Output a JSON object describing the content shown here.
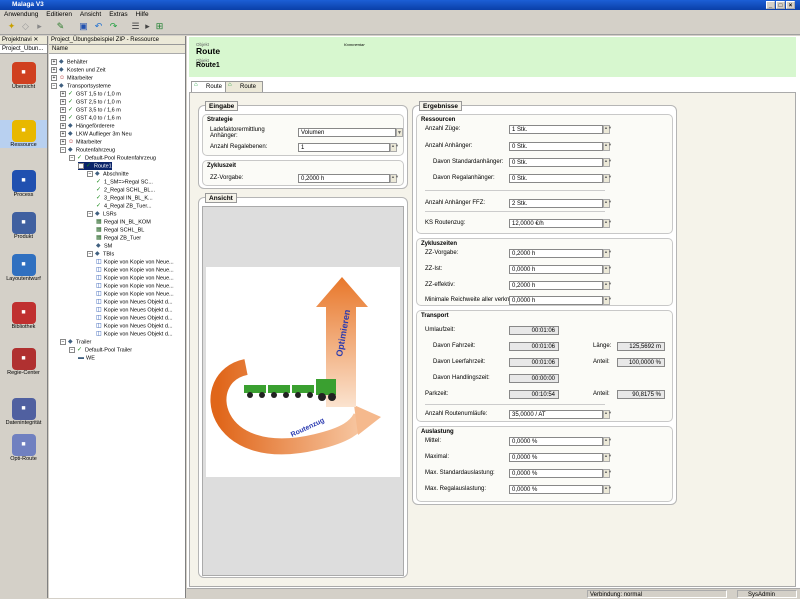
{
  "window": {
    "title": "Malaga V3"
  },
  "menu": [
    "Anwendung",
    "Editieren",
    "Ansicht",
    "Extras",
    "Hilfe"
  ],
  "leftnav": {
    "header": "Projektnavi",
    "project_tab": "Project_Übun...",
    "items": [
      {
        "label": "Übersicht",
        "icon": "overview-icon",
        "color": "#d04020"
      },
      {
        "label": "Ressource",
        "icon": "resource-icon",
        "color": "#e8b800"
      },
      {
        "label": "Process",
        "icon": "process-icon",
        "color": "#2050b0"
      },
      {
        "label": "Produkt",
        "icon": "product-icon",
        "color": "#4060a0"
      },
      {
        "label": "Layoutentwurf",
        "icon": "layout-icon",
        "color": "#3070c0"
      },
      {
        "label": "Bibliothek",
        "icon": "library-icon",
        "color": "#c03030"
      },
      {
        "label": "Regie-Center",
        "icon": "control-center-icon",
        "color": "#b03030"
      },
      {
        "label": "Datenintegrität",
        "icon": "data-quality-icon",
        "color": "#5060a0"
      },
      {
        "label": "Opti-Route",
        "icon": "opti-route-icon",
        "color": "#7080c0"
      }
    ]
  },
  "tree": {
    "header": "Project_Übungsbeispiel ZIP - Ressource",
    "column": "Name",
    "nodes": [
      {
        "label": "Behälter",
        "indent": 0,
        "exp": "+",
        "icon": "container-icon"
      },
      {
        "label": "Kosten und Zeit",
        "indent": 0,
        "exp": "+",
        "icon": "cost-icon"
      },
      {
        "label": "Mitarbeiter",
        "indent": 0,
        "exp": "+",
        "icon": "worker-icon"
      },
      {
        "label": "Transportsysteme",
        "indent": 0,
        "exp": "-",
        "icon": "transport-icon"
      },
      {
        "label": "GST 1,5 to / 1,0 m",
        "indent": 1,
        "exp": "+",
        "icon": "forklift-icon"
      },
      {
        "label": "GST 2,5 to / 1,0 m",
        "indent": 1,
        "exp": "+",
        "icon": "forklift-icon"
      },
      {
        "label": "GST 3,5 to / 1,6 m",
        "indent": 1,
        "exp": "+",
        "icon": "forklift-icon"
      },
      {
        "label": "GST 4,0 to / 1,6 m",
        "indent": 1,
        "exp": "+",
        "icon": "forklift-icon"
      },
      {
        "label": "Hängeförderere",
        "indent": 1,
        "exp": "+",
        "icon": "conveyor-icon"
      },
      {
        "label": "LKW Auflieger 3m Neu",
        "indent": 1,
        "exp": "+",
        "icon": "truck-icon"
      },
      {
        "label": "Mitarbeiter",
        "indent": 1,
        "exp": "+",
        "icon": "worker-icon"
      },
      {
        "label": "Routenfahrzeug",
        "indent": 1,
        "exp": "-",
        "icon": "route-vehicle-icon"
      },
      {
        "label": "Default-Pool Routenfahrzeug",
        "indent": 2,
        "exp": "-",
        "icon": "pool-icon"
      },
      {
        "label": "Route1",
        "indent": 3,
        "exp": "-",
        "icon": "route-icon",
        "selected": true
      },
      {
        "label": "Abschnitte",
        "indent": 4,
        "exp": "-",
        "icon": "section-icon"
      },
      {
        "label": "1_SM=>Regal SC...",
        "indent": 5,
        "exp": "",
        "icon": "check-icon"
      },
      {
        "label": "2_Regal SCHL_BL...",
        "indent": 5,
        "exp": "",
        "icon": "check-icon"
      },
      {
        "label": "3_Regal IN_BL_K...",
        "indent": 5,
        "exp": "",
        "icon": "check-icon"
      },
      {
        "label": "4_Regal ZB_Tuer...",
        "indent": 5,
        "exp": "",
        "icon": "check-icon"
      },
      {
        "label": "LSRs",
        "indent": 4,
        "exp": "-",
        "icon": "lsr-icon"
      },
      {
        "label": "Regal IN_BL_KOM",
        "indent": 5,
        "exp": "",
        "icon": "shelf-icon"
      },
      {
        "label": "Regal SCHL_BL",
        "indent": 5,
        "exp": "",
        "icon": "shelf-icon"
      },
      {
        "label": "Regal ZB_Tuer",
        "indent": 5,
        "exp": "",
        "icon": "shelf-icon"
      },
      {
        "label": "SM",
        "indent": 5,
        "exp": "",
        "icon": "sm-icon"
      },
      {
        "label": "TBIs",
        "indent": 4,
        "exp": "-",
        "icon": "tbi-icon"
      },
      {
        "label": "Kopie von Kopie von Neue...",
        "indent": 5,
        "exp": "",
        "icon": "item-icon"
      },
      {
        "label": "Kopie von Kopie von Neue...",
        "indent": 5,
        "exp": "",
        "icon": "item-icon"
      },
      {
        "label": "Kopie von Kopie von Neue...",
        "indent": 5,
        "exp": "",
        "icon": "item-icon"
      },
      {
        "label": "Kopie von Kopie von Neue...",
        "indent": 5,
        "exp": "",
        "icon": "item-icon"
      },
      {
        "label": "Kopie von Kopie von Neue...",
        "indent": 5,
        "exp": "",
        "icon": "item-icon"
      },
      {
        "label": "Kopie von Neues Objekt d...",
        "indent": 5,
        "exp": "",
        "icon": "item-icon"
      },
      {
        "label": "Kopie von Neues Objekt d...",
        "indent": 5,
        "exp": "",
        "icon": "item-icon"
      },
      {
        "label": "Kopie von Neues Objekt d...",
        "indent": 5,
        "exp": "",
        "icon": "item-icon"
      },
      {
        "label": "Kopie von Neues Objekt d...",
        "indent": 5,
        "exp": "",
        "icon": "item-icon"
      },
      {
        "label": "Kopie von Neues Objekt d...",
        "indent": 5,
        "exp": "",
        "icon": "item-icon"
      },
      {
        "label": "Trailer",
        "indent": 1,
        "exp": "-",
        "icon": "trailer-icon"
      },
      {
        "label": "Default-Pool Trailer",
        "indent": 2,
        "exp": "-",
        "icon": "pool-icon"
      },
      {
        "label": "WE",
        "indent": 3,
        "exp": "",
        "icon": "we-icon"
      }
    ]
  },
  "header": {
    "type_caption": "Objekt",
    "title": "Route",
    "object_caption": "Objekt",
    "object_name": "Route1",
    "tag": "Kommentar"
  },
  "tabs": [
    "Route",
    "Route"
  ],
  "eingabe": {
    "title": "Eingabe",
    "strategie": {
      "title": "Strategie",
      "ladefaktor_label": "Ladefaktorermittlung Anhänger:",
      "ladefaktor_value": "Volumen",
      "regal_label": "Anzahl Regalebenen:",
      "regal_value": "1"
    },
    "zykluszeit": {
      "title": "Zykluszeit",
      "zz_label": "ZZ-Vorgabe:",
      "zz_value": "0,2000 h"
    }
  },
  "ansicht": {
    "title": "Ansicht",
    "arrow_up_label": "Optimieren",
    "arrow_curve_label": "Routenzug"
  },
  "ergebnisse": {
    "title": "Ergebnisse",
    "ressourcen": {
      "title": "Ressourcen",
      "rows": [
        {
          "label": "Anzahl Züge:",
          "value": "1 Stk."
        },
        {
          "label": "Anzahl Anhänger:",
          "value": "0 Stk."
        },
        {
          "label": "Davon Standardanhänger:",
          "value": "0 Stk."
        },
        {
          "label": "Davon Regalanhänger:",
          "value": "0 Stk."
        },
        {
          "label": "Anzahl Anhänger FFZ:",
          "value": "2 Stk."
        },
        {
          "label": "KS Routenzug:",
          "value": "12,0000 €/h"
        }
      ]
    },
    "zykluszeiten": {
      "title": "Zykluszeiten",
      "rows": [
        {
          "label": "ZZ-Vorgabe:",
          "value": "0,2000 h"
        },
        {
          "label": "ZZ-Ist:",
          "value": "0,0000 h"
        },
        {
          "label": "ZZ-effektiv:",
          "value": "0,2000 h"
        },
        {
          "label": "Minimale Reichweite aller verknüpften:",
          "value": "0,0000 h"
        }
      ]
    },
    "transport": {
      "title": "Transport",
      "umlaufzeit_label": "Umlaufzeit:",
      "umlaufzeit_value": "00:01:06",
      "fahrzeit_label": "Davon Fahrzeit:",
      "fahrzeit_value": "00:01:06",
      "laenge_label": "Länge:",
      "laenge_value": "125,5692 m",
      "leerfahrzeit_label": "Davon Leerfahrzeit:",
      "leerfahrzeit_value": "00:01:06",
      "anteil1_label": "Anteil:",
      "anteil1_value": "100,0000 %",
      "handling_label": "Davon Handlingszeit:",
      "handling_value": "00:00:00",
      "parkzeit_label": "Parkzeit:",
      "parkzeit_value": "00:10:54",
      "anteil2_label": "Anteil:",
      "anteil2_value": "90,8175 %",
      "routenumlaeufe_label": "Anzahl Routenumläufe:",
      "routenumlaeufe_value": "35,0000 / AT"
    },
    "auslastung": {
      "title": "Auslastung",
      "rows": [
        {
          "label": "Mittel:",
          "value": "0,0000 %"
        },
        {
          "label": "Maximal:",
          "value": "0,0000 %"
        },
        {
          "label": "Max. Standardauslastung:",
          "value": "0,0000 %"
        },
        {
          "label": "Max. Regalauslastung:",
          "value": "0,0000 %"
        }
      ]
    }
  },
  "status": {
    "connection": "Verbindung: normal",
    "user": "SysAdmin"
  }
}
